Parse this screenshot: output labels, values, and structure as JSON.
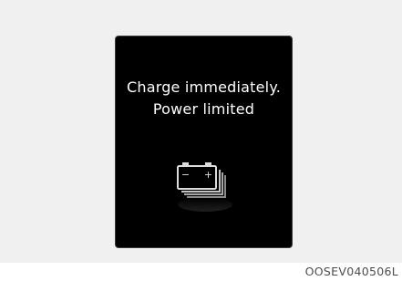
{
  "warning": {
    "line1": "Charge immediately.",
    "line2": "Power limited"
  },
  "icon": {
    "name": "battery-warning-icon",
    "minus_glyph": "−",
    "plus_glyph": "+"
  },
  "figure_code": "OOSEV040506L",
  "colors": {
    "page_background": "#f0f0f0",
    "screen_background": "#000000",
    "text": "#ffffff",
    "icon": "#dcdcdc",
    "caption": "#4d4d4d"
  }
}
